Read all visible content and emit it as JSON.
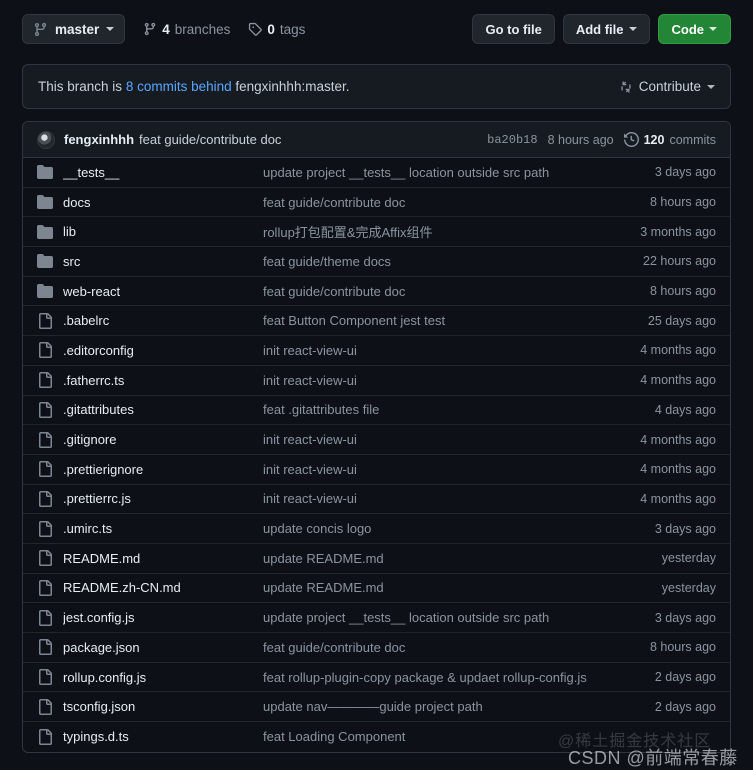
{
  "toolbar": {
    "branch_button": {
      "label": "master",
      "icon": "branch-icon"
    },
    "branches": {
      "count": "4",
      "label": "branches",
      "icon": "branch-icon"
    },
    "tags": {
      "count": "0",
      "label": "tags",
      "icon": "tag-icon"
    },
    "go_to_file": "Go to file",
    "add_file": "Add file",
    "code": "Code"
  },
  "banner": {
    "prefix": "This branch is",
    "link": "8 commits behind",
    "suffix": "fengxinhhh:master.",
    "contribute": "Contribute"
  },
  "commit_header": {
    "author": "fengxinhhh",
    "message": "feat guide/contribute doc",
    "sha": "ba20b18",
    "time": "8 hours ago",
    "commits_count": "120",
    "commits_label": "commits"
  },
  "colors": {
    "accent_green": "#238636",
    "link_blue": "#58a6ff",
    "page_bg": "#0d1117",
    "panel_bg": "#161b22",
    "border": "#30363d",
    "icon_gray": "#7d8590",
    "text_primary": "#e6edf3",
    "text_muted": "#8b949e"
  },
  "files": [
    {
      "type": "folder",
      "name": "__tests__",
      "message": "update project __tests__ location outside src path",
      "age": "3 days ago"
    },
    {
      "type": "folder",
      "name": "docs",
      "message": "feat guide/contribute doc",
      "age": "8 hours ago"
    },
    {
      "type": "folder",
      "name": "lib",
      "message": "rollup打包配置&完成Affix组件",
      "age": "3 months ago"
    },
    {
      "type": "folder",
      "name": "src",
      "message": "feat guide/theme docs",
      "age": "22 hours ago"
    },
    {
      "type": "folder",
      "name": "web-react",
      "message": "feat guide/contribute doc",
      "age": "8 hours ago"
    },
    {
      "type": "file",
      "name": ".babelrc",
      "message": "feat Button Component jest test",
      "age": "25 days ago"
    },
    {
      "type": "file",
      "name": ".editorconfig",
      "message": "init react-view-ui",
      "age": "4 months ago"
    },
    {
      "type": "file",
      "name": ".fatherrc.ts",
      "message": "init react-view-ui",
      "age": "4 months ago"
    },
    {
      "type": "file",
      "name": ".gitattributes",
      "message": "feat .gitattributes file",
      "age": "4 days ago"
    },
    {
      "type": "file",
      "name": ".gitignore",
      "message": "init react-view-ui",
      "age": "4 months ago"
    },
    {
      "type": "file",
      "name": ".prettierignore",
      "message": "init react-view-ui",
      "age": "4 months ago"
    },
    {
      "type": "file",
      "name": ".prettierrc.js",
      "message": "init react-view-ui",
      "age": "4 months ago"
    },
    {
      "type": "file",
      "name": ".umirc.ts",
      "message": "update concis logo",
      "age": "3 days ago"
    },
    {
      "type": "file",
      "name": "README.md",
      "message": "update README.md",
      "age": "yesterday"
    },
    {
      "type": "file",
      "name": "README.zh-CN.md",
      "message": "update README.md",
      "age": "yesterday"
    },
    {
      "type": "file",
      "name": "jest.config.js",
      "message": "update project __tests__ location outside src path",
      "age": "3 days ago"
    },
    {
      "type": "file",
      "name": "package.json",
      "message": "feat guide/contribute doc",
      "age": "8 hours ago"
    },
    {
      "type": "file",
      "name": "rollup.config.js",
      "message": "feat rollup-plugin-copy package & updaet rollup-config.js",
      "age": "2 days ago"
    },
    {
      "type": "file",
      "name": "tsconfig.json",
      "message": "update nav————guide project path",
      "age": "2 days ago"
    },
    {
      "type": "file",
      "name": "typings.d.ts",
      "message": "feat Loading Component",
      "age": ""
    }
  ],
  "watermarks": {
    "juejin": "@稀土掘金技术社区",
    "csdn": "CSDN @前端常春藤"
  }
}
